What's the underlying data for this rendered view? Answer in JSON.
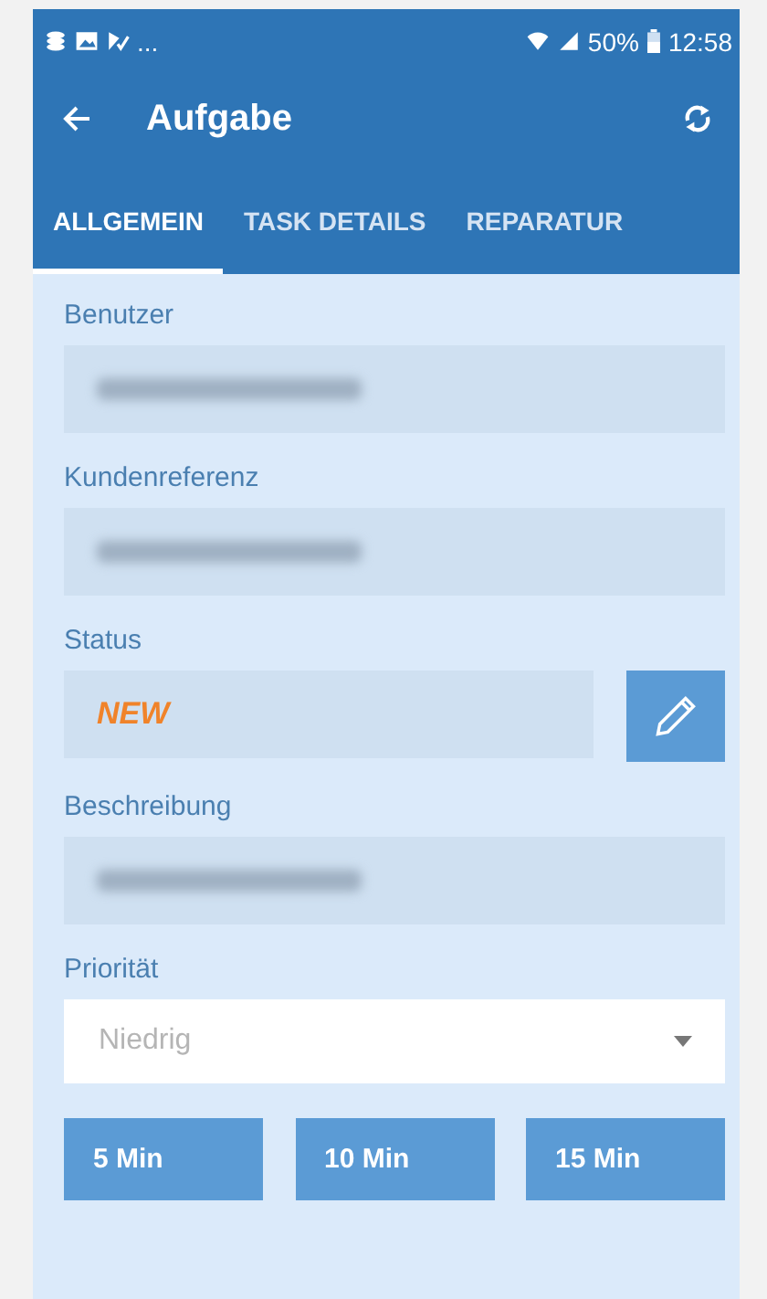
{
  "status_bar": {
    "overflow": "...",
    "battery": "50%",
    "time": "12:58"
  },
  "toolbar": {
    "title": "Aufgabe"
  },
  "tabs": [
    {
      "label": "ALLGEMEIN",
      "selected": true
    },
    {
      "label": "TASK DETAILS",
      "selected": false
    },
    {
      "label": "REPARATUR",
      "selected": false
    }
  ],
  "fields": [
    {
      "label": "Benutzer",
      "kind": "blurred"
    },
    {
      "label": "Kundenreferenz",
      "kind": "blurred"
    },
    {
      "label": "Status",
      "kind": "status",
      "value": "NEW",
      "editable": true
    },
    {
      "label": "Beschreibung",
      "kind": "blurred"
    },
    {
      "label": "Priorität",
      "kind": "dropdown",
      "placeholder": "Niedrig"
    }
  ],
  "time_buttons": [
    "5 Min",
    "10 Min",
    "15 Min"
  ]
}
